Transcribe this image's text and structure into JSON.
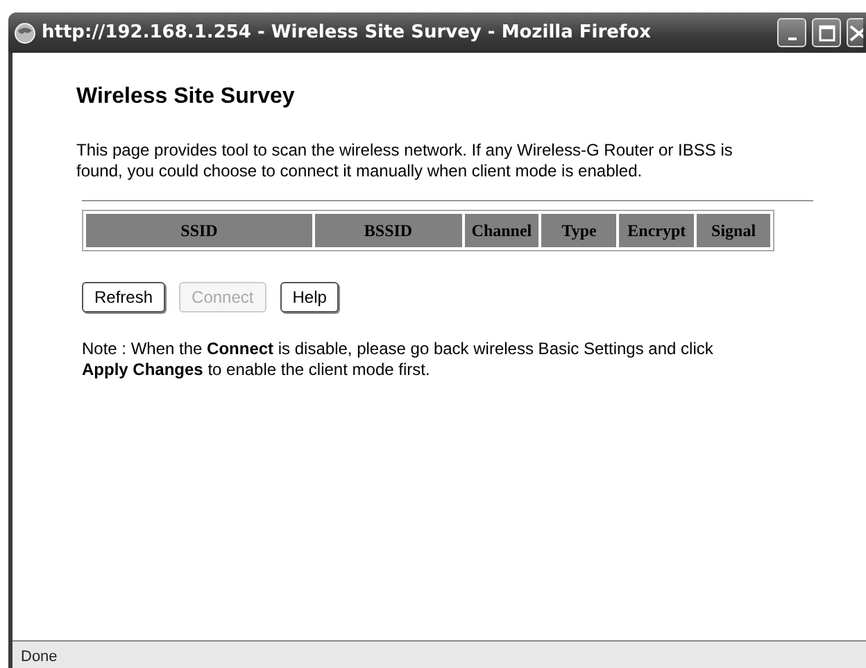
{
  "window": {
    "title": "http://192.168.1.254 - Wireless Site Survey - Mozilla Firefox"
  },
  "heading": "Wireless Site Survey",
  "description": "This page provides tool to scan the wireless network. If any Wireless-G Router or IBSS is found, you could choose to connect it manually when client mode is enabled.",
  "table": {
    "columns": [
      "SSID",
      "BSSID",
      "Channel",
      "Type",
      "Encrypt",
      "Signal"
    ]
  },
  "buttons": [
    {
      "label": "Refresh",
      "disabled": false
    },
    {
      "label": "Connect",
      "disabled": true
    },
    {
      "label": "Help",
      "disabled": false
    }
  ],
  "note": "Note :  When the **Connect** is disable, please go back wireless Basic Settings and click **Apply Changes** to enable the client mode first.",
  "status_bar": "Done"
}
